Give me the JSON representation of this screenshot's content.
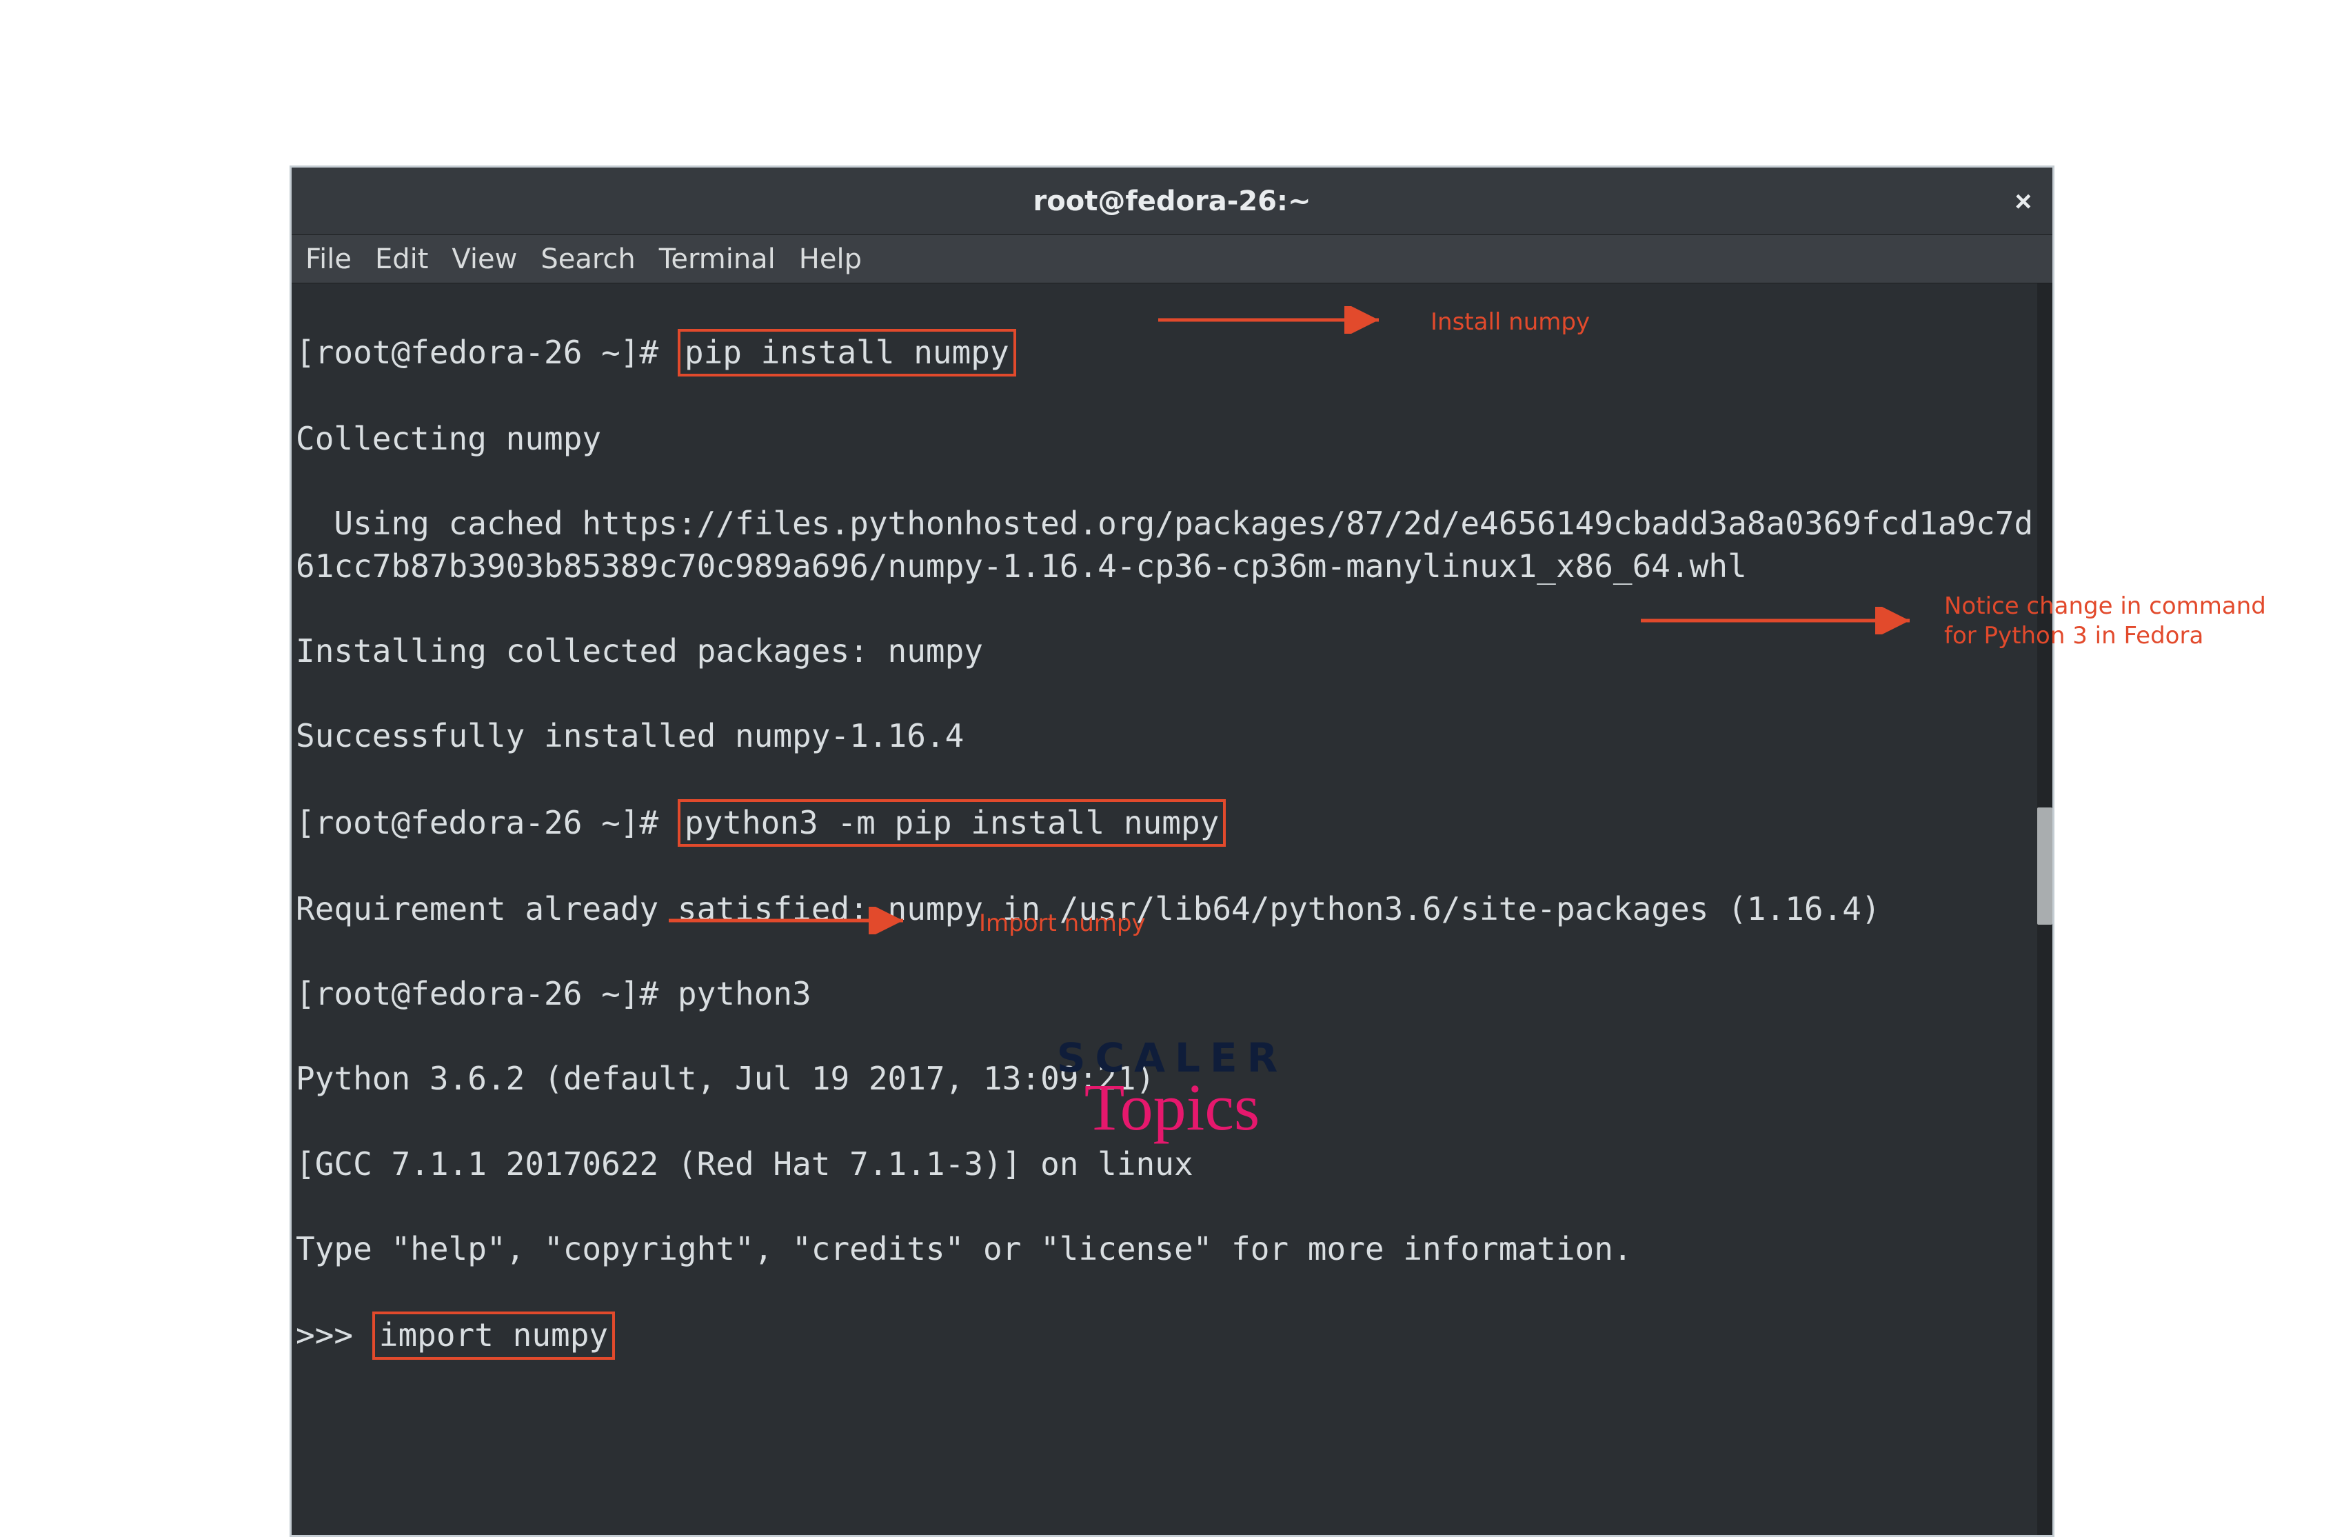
{
  "window": {
    "title": "root@fedora-26:~"
  },
  "menu": {
    "file": "File",
    "edit": "Edit",
    "view": "View",
    "search": "Search",
    "terminal": "Terminal",
    "help": "Help"
  },
  "term": {
    "prompt": "[root@fedora-26 ~]# ",
    "cmd1": "pip install numpy",
    "l2": "Collecting numpy",
    "l3": "  Using cached https://files.pythonhosted.org/packages/87/2d/e4656149cbadd3a8a0369fcd1a9c7d61cc7b87b3903b85389c70c989a696/numpy-1.16.4-cp36-cp36m-manylinux1_x86_64.whl",
    "l4": "Installing collected packages: numpy",
    "l5": "Successfully installed numpy-1.16.4",
    "cmd2": "python3 -m pip install numpy",
    "l7": "Requirement already satisfied: numpy in /usr/lib64/python3.6/site-packages (1.16.4)",
    "l8": "[root@fedora-26 ~]# python3",
    "l9": "Python 3.6.2 (default, Jul 19 2017, 13:09:21)",
    "l10": "[GCC 7.1.1 20170622 (Red Hat 7.1.1-3)] on linux",
    "l11": "Type \"help\", \"copyright\", \"credits\" or \"license\" for more information.",
    "pyprompt": ">>> ",
    "cmd3": "import numpy"
  },
  "annot": {
    "a1": "Install numpy",
    "a2_line1": "Notice change in command",
    "a2_line2": "for Python 3 in Fedora",
    "a3": "Import numpy"
  },
  "logo": {
    "line1": "SCALER",
    "line2": "Topics"
  }
}
